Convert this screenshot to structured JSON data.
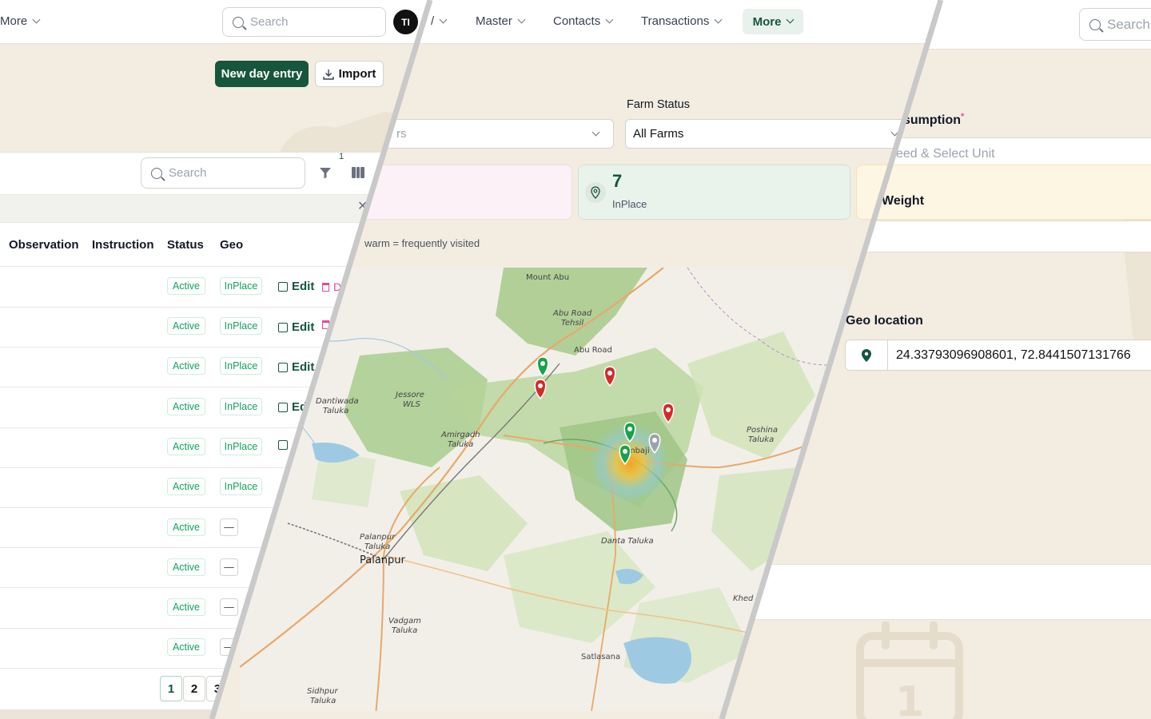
{
  "left_panel": {
    "nav_more": "More",
    "search_placeholder": "Search",
    "avatar_initials": "TI",
    "new_entry_label": "New day entry",
    "import_label": "Import",
    "table_search_placeholder": "Search",
    "filter_count": "1",
    "columns": [
      "Observation",
      "Instruction",
      "Status",
      "Geo"
    ],
    "rows": [
      {
        "status": "Active",
        "geo": "InPlace",
        "edit": "Edit",
        "delete": "De"
      },
      {
        "status": "Active",
        "geo": "InPlace",
        "edit": "Edit"
      },
      {
        "status": "Active",
        "geo": "InPlace",
        "edit": "Edit"
      },
      {
        "status": "Active",
        "geo": "InPlace",
        "edit": "Ed"
      },
      {
        "status": "Active",
        "geo": "InPlace"
      },
      {
        "status": "Active",
        "geo": "InPlace"
      },
      {
        "status": "Active",
        "geo": "—"
      },
      {
        "status": "Active",
        "geo": "—"
      },
      {
        "status": "Active",
        "geo": "—"
      },
      {
        "status": "Active",
        "geo": "—"
      }
    ],
    "pages": [
      "1",
      "2",
      "3"
    ]
  },
  "middle_panel": {
    "nav": [
      "Master",
      "Contacts",
      "Transactions"
    ],
    "nav_active": "More",
    "first_select_fragment": "rs",
    "farm_status_label": "Farm Status",
    "farm_status_value": "All Farms",
    "stat_inplace": {
      "value": "7",
      "label": "InPlace"
    },
    "heat_note": "warm = frequently visited",
    "map_labels": {
      "mount_abu": "Mount Abu",
      "abu_road_tehsil_1": "Abu Road",
      "abu_road_tehsil_2": "Tehsil",
      "abu_road": "Abu Road",
      "dantiwada_1": "Dantiwada",
      "dantiwada_2": "Taluka",
      "jessore_1": "Jessore",
      "jessore_2": "WLS",
      "amirgadh_1": "Amirgadh",
      "amirgadh_2": "Taluka",
      "poshina_1": "Poshina",
      "poshina_2": "Taluka",
      "ambaji": "Ambaji",
      "danta": "Danta Taluka",
      "palanpur_taluka_1": "Palanpur",
      "palanpur_taluka_2": "Taluka",
      "palanpur": "Palanpur",
      "vadgam_1": "Vadgam",
      "vadgam_2": "Taluka",
      "khed": "Khed",
      "satlasana": "Satlasana",
      "sidhpur_1": "Sidhpur",
      "sidhpur_2": "Taluka"
    }
  },
  "right_panel": {
    "search_placeholder": "Search",
    "consumption_label": "sumption",
    "required_mark": "*",
    "feed_placeholder": "eed & Select Unit",
    "weight_label": "Weight",
    "geo_label": "Geo location",
    "geo_value": "24.33793096908601, 72.8441507131766"
  },
  "colors": {
    "brand": "#17553d",
    "background": "#f3ece0",
    "active_green": "#12a15e",
    "danger_pink": "#e3499f",
    "marker_red": "#d42a2a",
    "marker_green": "#16a34a",
    "marker_gray": "#9ca3af"
  },
  "icons": [
    "search-icon",
    "chevron-down-icon",
    "download-icon",
    "filter-icon",
    "columns-icon",
    "close-icon",
    "edit-icon",
    "trash-icon",
    "location-pin-icon",
    "warning-icon",
    "calendar-icon"
  ]
}
